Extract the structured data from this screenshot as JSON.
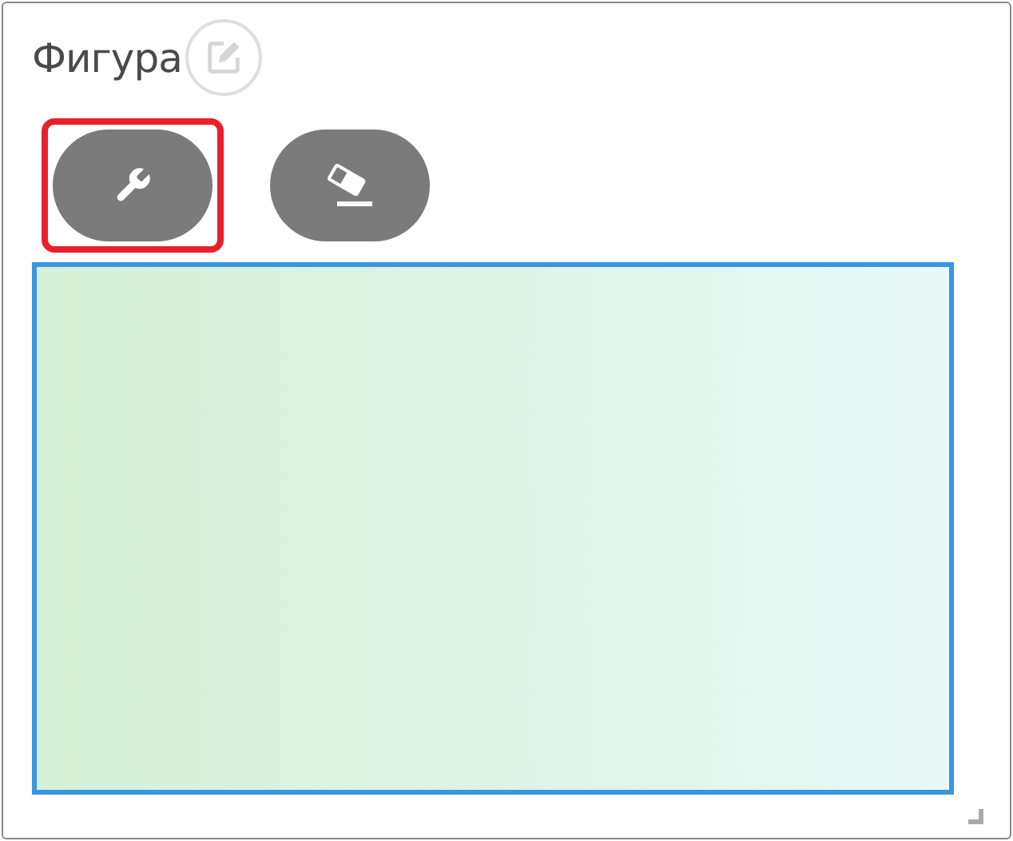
{
  "panel": {
    "title": "Фигура"
  },
  "tools": [
    {
      "kind": "wrench",
      "highlighted": true
    },
    {
      "kind": "eraser",
      "highlighted": false
    }
  ],
  "canvas": {
    "focused": true
  }
}
